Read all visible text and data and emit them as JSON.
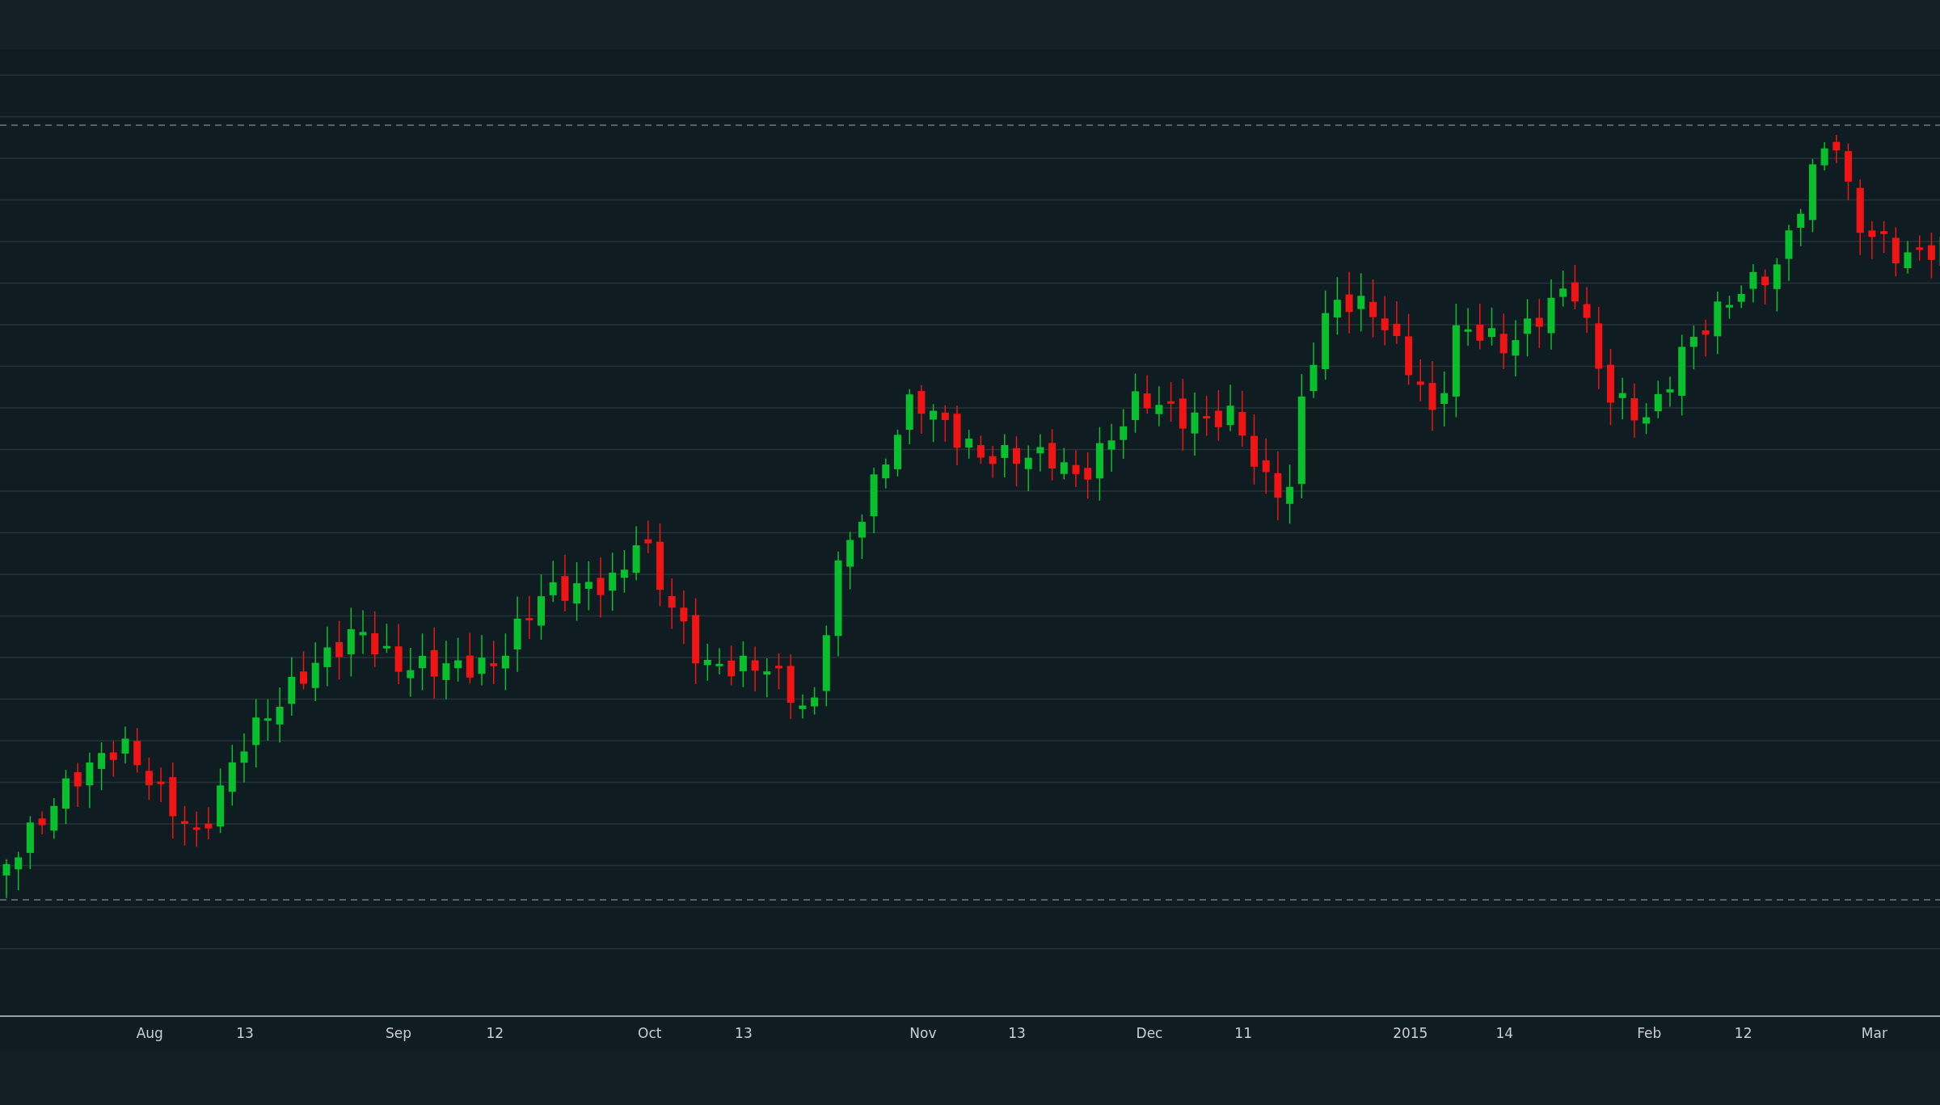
{
  "chart": {
    "x_axis_labels": [
      "Aug",
      "13",
      "Sep",
      "12",
      "Oct",
      "13",
      "Nov",
      "13",
      "Dec",
      "11",
      "2015",
      "14",
      "Feb",
      "12",
      "Mar"
    ]
  }
}
